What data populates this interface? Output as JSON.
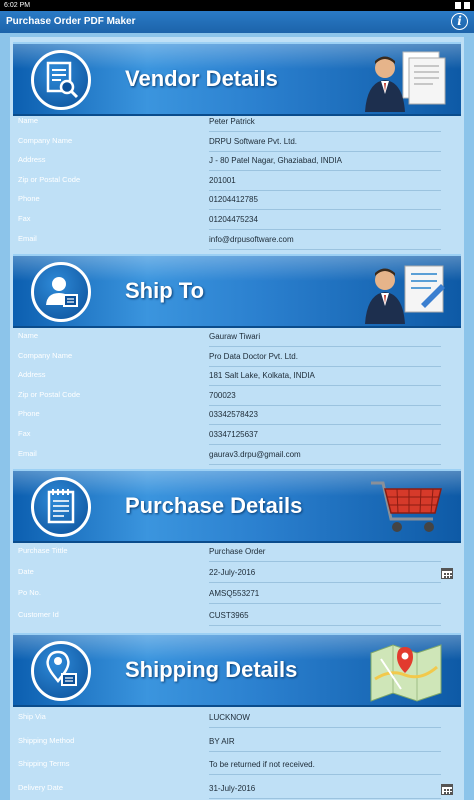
{
  "status_bar": {
    "time": "6:02 PM"
  },
  "app": {
    "title": "Purchase Order PDF Maker",
    "info_icon": "info-icon",
    "info_glyph": "i"
  },
  "vendor": {
    "title": "Vendor Details",
    "icon": "document-search-icon",
    "fields": [
      {
        "label": "Name",
        "value": "Peter Patrick"
      },
      {
        "label": "Company Name",
        "value": "DRPU Software Pvt. Ltd."
      },
      {
        "label": "Address",
        "value": "J - 80 Patel Nagar, Ghaziabad, INDIA"
      },
      {
        "label": "Zip or Postal Code",
        "value": "201001"
      },
      {
        "label": "Phone",
        "value": "01204412785"
      },
      {
        "label": "Fax",
        "value": "01204475234"
      },
      {
        "label": "Email",
        "value": "info@drpusoftware.com"
      }
    ]
  },
  "ship_to": {
    "title": "Ship To",
    "icon": "user-card-icon",
    "fields": [
      {
        "label": "Name",
        "value": "Gauraw Tiwari"
      },
      {
        "label": "Company Name",
        "value": "Pro Data Doctor Pvt. Ltd."
      },
      {
        "label": "Address",
        "value": "181 Salt Lake, Kolkata, INDIA"
      },
      {
        "label": "Zip or Postal Code",
        "value": "700023"
      },
      {
        "label": "Phone",
        "value": "03342578423"
      },
      {
        "label": "Fax",
        "value": "03347125637"
      },
      {
        "label": "Email",
        "value": "gaurav3.drpu@gmail.com"
      }
    ]
  },
  "purchase": {
    "title": "Purchase Details",
    "icon": "notepad-icon",
    "fields": [
      {
        "label": "Purchase Tittle",
        "value": "Purchase Order"
      },
      {
        "label": "Date",
        "value": "22-July-2016"
      },
      {
        "label": "Po No.",
        "value": "AMSQ553271"
      },
      {
        "label": "Customer Id",
        "value": "CUST3965"
      }
    ]
  },
  "shipping": {
    "title": "Shipping Details",
    "icon": "map-pin-icon",
    "fields": [
      {
        "label": "Ship Via",
        "value": "LUCKNOW"
      },
      {
        "label": "Shipping Method",
        "value": "BY AIR"
      },
      {
        "label": "Shipping Terms",
        "value": "To be returned if not received."
      },
      {
        "label": "Delivery Date",
        "value": "31-July-2016"
      }
    ]
  }
}
